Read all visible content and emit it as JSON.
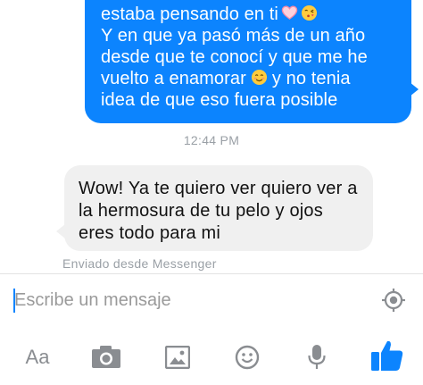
{
  "conversation": {
    "outgoing_message": {
      "lines": [
        "estaba pensando en ti",
        "Y en que ya pasó más de un año",
        "desde que te conocí y que me he",
        "vuelto a enamorar",
        "y no tenia",
        "idea de que eso fuera posible"
      ],
      "emojis": [
        "heart-emoji",
        "kiss-emoji",
        "smile-emoji"
      ],
      "color": "#0c84fe"
    },
    "timestamp": "12:44 PM",
    "incoming_message": {
      "lines": [
        "Wow! Ya te quiero ver quiero ver a",
        "la hermosura de tu pelo y ojos",
        "eres todo para  mi"
      ],
      "color": "#f0f0f0"
    },
    "sent_via": "Enviado desde Messenger"
  },
  "composer": {
    "placeholder": "Escribe un mensaje",
    "location_icon": "location-target-icon"
  },
  "toolbar": {
    "text_format_label": "Aa",
    "icons": [
      "camera-icon",
      "image-icon",
      "emoji-icon",
      "microphone-icon",
      "thumbs-up-icon"
    ],
    "like_color": "#0c84fe"
  }
}
